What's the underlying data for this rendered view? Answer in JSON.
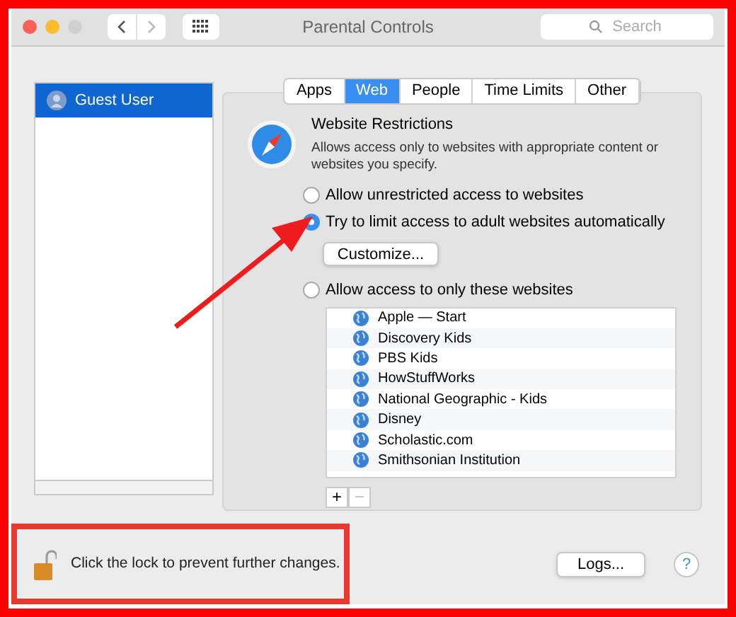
{
  "window": {
    "title": "Parental Controls"
  },
  "search": {
    "placeholder": "Search"
  },
  "tabs": [
    {
      "label": "Apps",
      "selected": false
    },
    {
      "label": "Web",
      "selected": true
    },
    {
      "label": "People",
      "selected": false
    },
    {
      "label": "Time Limits",
      "selected": false
    },
    {
      "label": "Other",
      "selected": false
    }
  ],
  "sidebar": {
    "users": [
      {
        "name": "Guest User",
        "selected": true
      }
    ]
  },
  "section": {
    "title": "Website Restrictions",
    "description": "Allows access only to websites with appropriate content or websites you specify."
  },
  "options": [
    {
      "label": "Allow unrestricted access to websites",
      "selected": false
    },
    {
      "label": "Try to limit access to adult websites automatically",
      "selected": true
    },
    {
      "label": "Allow access to only these websites",
      "selected": false
    }
  ],
  "customize_button": "Customize...",
  "websites": [
    "Apple — Start",
    "Discovery Kids",
    "PBS Kids",
    "HowStuffWorks",
    "National Geographic - Kids",
    "Disney",
    "Scholastic.com",
    "Smithsonian Institution"
  ],
  "list_buttons": [
    {
      "label": "+",
      "disabled": false
    },
    {
      "label": "−",
      "disabled": true
    }
  ],
  "lock_text": "Click the lock to prevent further changes.",
  "logs_button": "Logs...",
  "help_button": "?"
}
